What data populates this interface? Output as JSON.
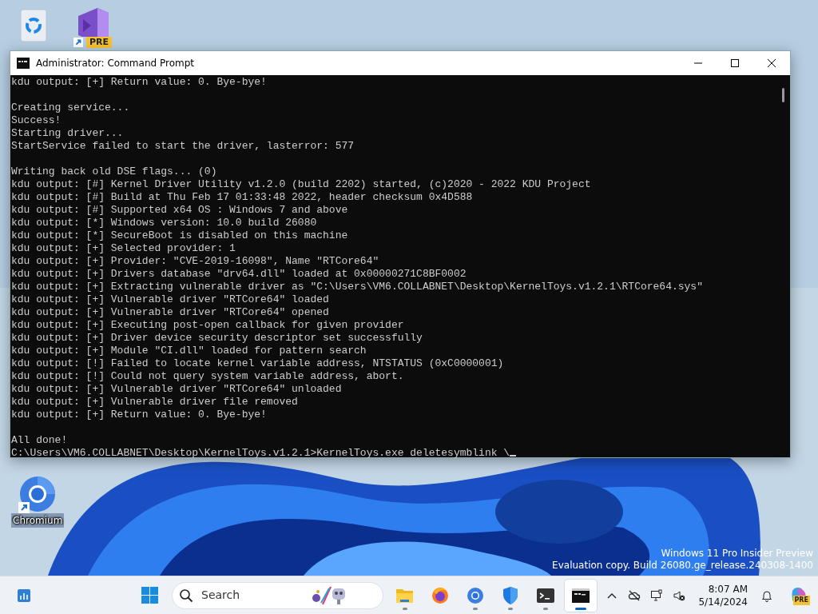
{
  "desktop": {
    "icons": [
      {
        "kind": "recycle-bin"
      },
      {
        "kind": "vs-preview",
        "shortcut": true,
        "badge": "PRE"
      },
      {
        "kind": "chromium",
        "shortcut": true,
        "label": "Chromium"
      }
    ],
    "watermark": [
      "Windows 11 Pro Insider Preview",
      "Evaluation copy. Build 26080.ge_release.240308-1400"
    ]
  },
  "window": {
    "title": "Administrator: Command Prompt",
    "cursor": true,
    "blocks": [
      [
        "kdu output: [+] Return value: 0. Bye-bye!"
      ],
      [
        "Creating service...",
        "Success!",
        "Starting driver...",
        "StartService failed to start the driver, lasterror: 577"
      ],
      [
        "Writing back old DSE flags... (0)",
        "kdu output: [#] Kernel Driver Utility v1.2.0 (build 2202) started, (c)2020 - 2022 KDU Project",
        "kdu output: [#] Build at Thu Feb 17 01:33:48 2022, header checksum 0x4D588",
        "kdu output: [#] Supported x64 OS : Windows 7 and above",
        "kdu output: [*] Windows version: 10.0 build 26080",
        "kdu output: [*] SecureBoot is disabled on this machine",
        "kdu output: [+] Selected provider: 1",
        "kdu output: [+] Provider: \"CVE-2019-16098\", Name \"RTCore64\"",
        "kdu output: [+] Drivers database \"drv64.dll\" loaded at 0x00000271C8BF0002",
        "kdu output: [+] Extracting vulnerable driver as \"C:\\Users\\VM6.COLLABNET\\Desktop\\KernelToys.v1.2.1\\RTCore64.sys\"",
        "kdu output: [+] Vulnerable driver \"RTCore64\" loaded",
        "kdu output: [+] Vulnerable driver \"RTCore64\" opened",
        "kdu output: [+] Executing post-open callback for given provider",
        "kdu output: [+] Driver device security descriptor set successfully",
        "kdu output: [+] Module \"CI.dll\" loaded for pattern search",
        "kdu output: [!] Failed to locate kernel variable address, NTSTATUS (0xC0000001)",
        "kdu output: [!] Could not query system variable address, abort.",
        "kdu output: [+] Vulnerable driver \"RTCore64\" unloaded",
        "kdu output: [+] Vulnerable driver file removed",
        "kdu output: [+] Return value: 0. Bye-bye!"
      ],
      [
        "All done!",
        "C:\\Users\\VM6.COLLABNET\\Desktop\\KernelToys.v1.2.1>KernelToys.exe deletesymblink \\"
      ]
    ]
  },
  "taskbar": {
    "search": {
      "placeholder": "Search"
    },
    "apps": [
      {
        "kind": "widgets",
        "running": false,
        "selected": false
      },
      {
        "kind": "start",
        "running": false,
        "selected": false
      },
      {
        "kind": "files",
        "running": true,
        "selected": false
      },
      {
        "kind": "firefox",
        "running": false,
        "selected": false
      },
      {
        "kind": "chromium",
        "running": true,
        "selected": false
      },
      {
        "kind": "defender",
        "running": true,
        "selected": false
      },
      {
        "kind": "terminal",
        "running": true,
        "selected": false
      },
      {
        "kind": "cmd",
        "running": true,
        "selected": true
      }
    ],
    "tray": [
      {
        "kind": "chevron"
      },
      {
        "kind": "network-off"
      },
      {
        "kind": "display"
      },
      {
        "kind": "volume-muted"
      },
      {
        "kind": "clock",
        "time": "8:07 AM",
        "date": "5/14/2024"
      },
      {
        "kind": "bell"
      },
      {
        "kind": "copilot",
        "badge": "PRE"
      }
    ]
  }
}
